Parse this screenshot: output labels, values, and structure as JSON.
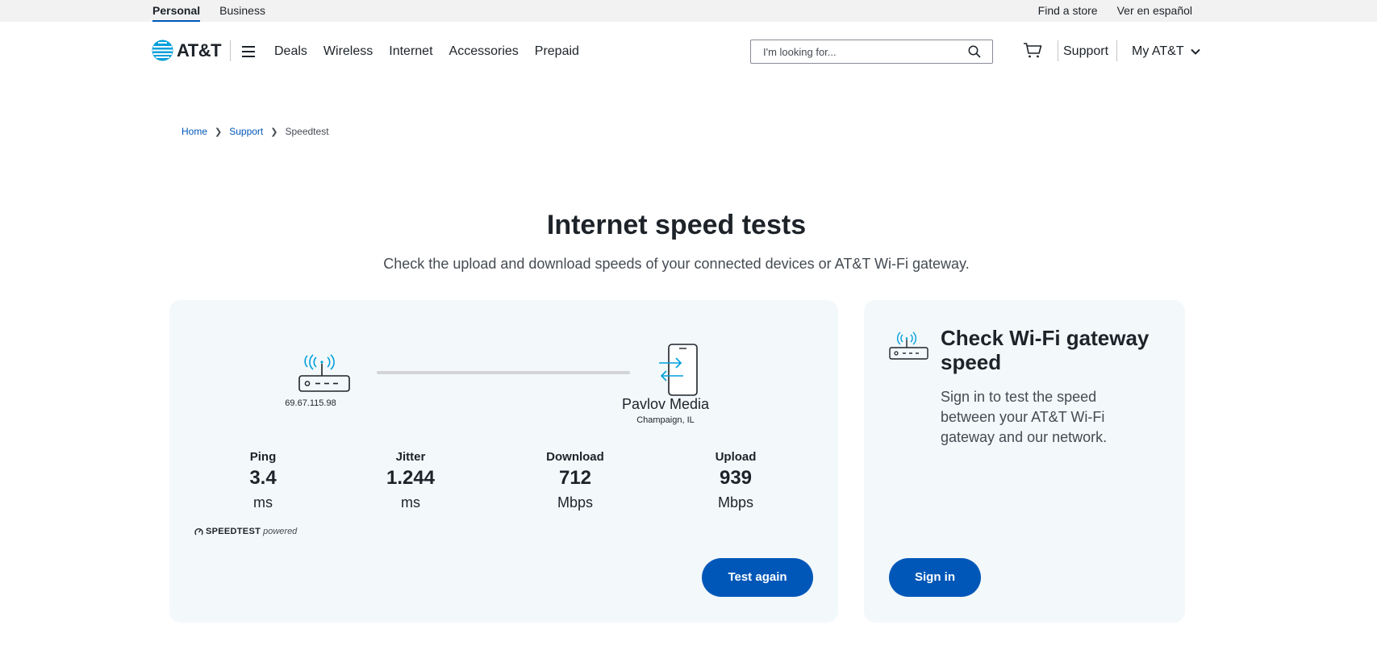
{
  "utility": {
    "tabs": [
      {
        "label": "Personal"
      },
      {
        "label": "Business"
      }
    ],
    "links": [
      {
        "label": "Find a store"
      },
      {
        "label": "Ver en español"
      }
    ]
  },
  "header": {
    "logo_text": "AT&T",
    "nav": [
      "Deals",
      "Wireless",
      "Internet",
      "Accessories",
      "Prepaid"
    ],
    "search_placeholder": "I'm looking for...",
    "support_label": "Support",
    "myatt_label": "My AT&T"
  },
  "breadcrumb": {
    "items": [
      "Home",
      "Support"
    ],
    "current": "Speedtest"
  },
  "page": {
    "title": "Internet speed tests",
    "subtitle": "Check the upload and download speeds of your connected devices or AT&T Wi-Fi gateway."
  },
  "speed_card": {
    "ip": "69.67.115.98",
    "server_name": "Pavlov Media",
    "server_location": "Champaign, IL",
    "metrics": [
      {
        "label": "Ping",
        "value": "3.4",
        "unit": "ms"
      },
      {
        "label": "Jitter",
        "value": "1.244",
        "unit": "ms"
      },
      {
        "label": "Download",
        "value": "712",
        "unit": "Mbps"
      },
      {
        "label": "Upload",
        "value": "939",
        "unit": "Mbps"
      }
    ],
    "brand_name": "SPEEDTEST",
    "brand_suffix": "powered",
    "button_label": "Test again"
  },
  "gateway_card": {
    "title": "Check Wi-Fi gateway speed",
    "description": "Sign in to test the speed between your AT&T Wi-Fi gateway and our network.",
    "button_label": "Sign in"
  },
  "colors": {
    "brand_blue": "#0057b8",
    "icon_cyan": "#009fdb",
    "card_bg": "#f3f8fb"
  }
}
